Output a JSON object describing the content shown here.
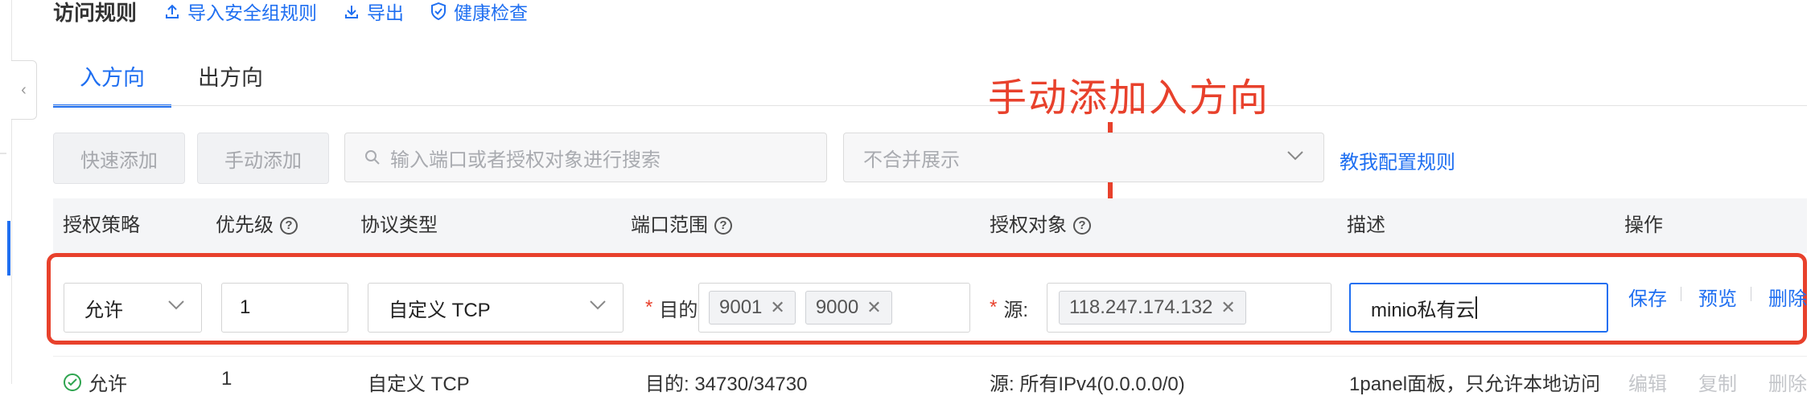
{
  "header": {
    "title": "访问规则",
    "links": [
      {
        "label": "导入安全组规则",
        "icon": "upload-icon"
      },
      {
        "label": "导出",
        "icon": "download-icon"
      },
      {
        "label": "健康检查",
        "icon": "shield-check-icon"
      }
    ]
  },
  "tabs": [
    {
      "label": "入方向",
      "active": true
    },
    {
      "label": "出方向",
      "active": false
    }
  ],
  "annotation": {
    "text": "手动添加入方向",
    "color": "#e8412c"
  },
  "toolbar": {
    "quick_add": "快速添加",
    "manual_add": "手动添加",
    "search_placeholder": "输入端口或者授权对象进行搜索",
    "merge_select": "不合并展示",
    "help_link": "教我配置规则"
  },
  "table": {
    "columns": {
      "policy": "授权策略",
      "priority": "优先级",
      "protocol": "协议类型",
      "port": "端口范围",
      "object": "授权对象",
      "desc": "描述",
      "actions": "操作"
    },
    "edit_row": {
      "policy": "允许",
      "priority": "1",
      "protocol": "自定义 TCP",
      "port_label": "目的",
      "port_tags": [
        "9001",
        "9000"
      ],
      "source_label": "源:",
      "source_tags": [
        "118.247.174.132"
      ],
      "description": "minio私有云",
      "save": "保存",
      "preview": "预览",
      "delete": "删除"
    },
    "row2": {
      "policy": "允许",
      "priority": "1",
      "protocol": "自定义 TCP",
      "port": "目的: 34730/34730",
      "source": "源: 所有IPv4(0.0.0.0/0)",
      "description": "1panel面板，只允许本地访问",
      "edit": "编辑",
      "copy": "复制",
      "delete": "删除"
    }
  },
  "colors": {
    "accent": "#1f6ff1",
    "highlight": "#e8412c"
  }
}
